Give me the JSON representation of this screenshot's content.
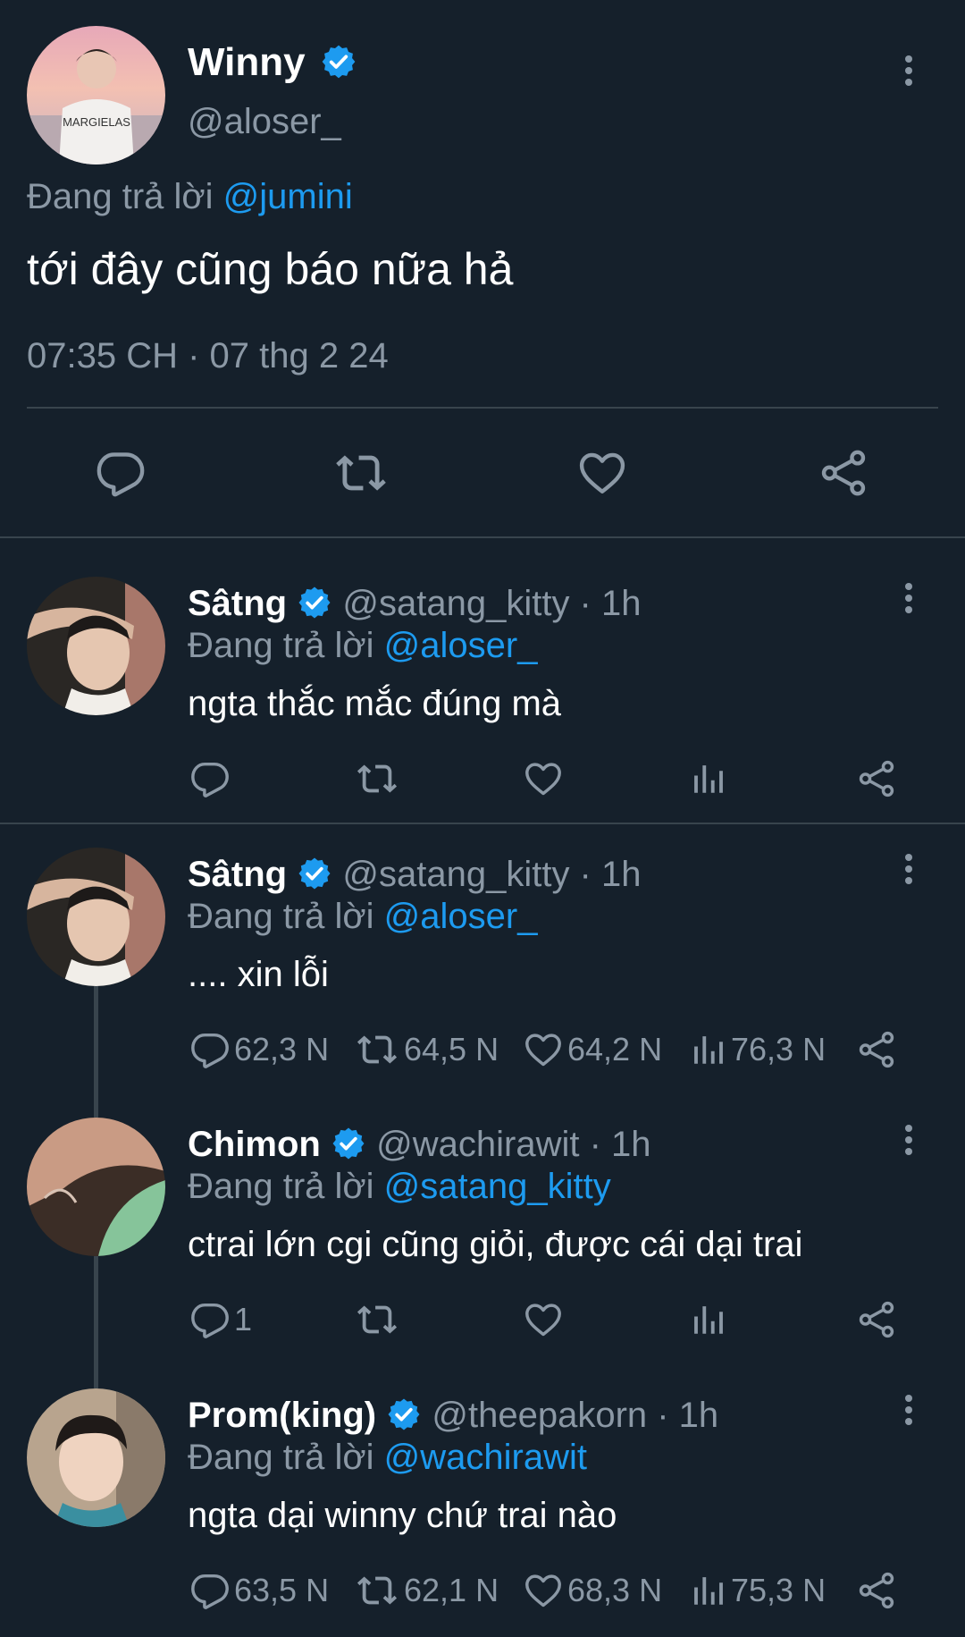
{
  "main_tweet": {
    "name": "Winny",
    "handle": "@aloser_",
    "reply_prefix": "Đang trả lời",
    "reply_to": "@jumini",
    "text": "tới đây cũng báo nữa hả",
    "timestamp": "07:35 CH · 07 thg 2 24"
  },
  "replies": [
    {
      "name": "Sâtng",
      "handle_time": "@satang_kitty · 1h",
      "reply_prefix": "Đang trả lời",
      "reply_to": "@aloser_",
      "text": "ngta thắc mắc đúng mà",
      "replies": "",
      "retweets": "",
      "likes": "",
      "views": ""
    },
    {
      "name": "Sâtng",
      "handle_time": "@satang_kitty · 1h",
      "reply_prefix": "Đang trả lời",
      "reply_to": "@aloser_",
      "text": ".... xin lỗi",
      "replies": "62,3 N",
      "retweets": "64,5 N",
      "likes": "64,2 N",
      "views": "76,3 N"
    },
    {
      "name": "Chimon",
      "handle_time": "@wachirawit · 1h",
      "reply_prefix": "Đang trả lời",
      "reply_to": "@satang_kitty",
      "text": "ctrai lớn cgi cũng giỏi, được cái dại trai",
      "replies": "1",
      "retweets": "",
      "likes": "",
      "views": ""
    },
    {
      "name": "Prom(king)",
      "handle_time": "@theepakorn · 1h",
      "reply_prefix": "Đang trả lời",
      "reply_to": "@wachirawit",
      "text": "ngta dại winny chứ trai nào",
      "replies": "63,5 N",
      "retweets": "62,1 N",
      "likes": "68,3 N",
      "views": "75,3 N"
    }
  ],
  "avatar_labels": {
    "winny_shirt": "MARGIELAS"
  },
  "colors": {
    "background": "#15202b",
    "text": "#ffffff",
    "secondary": "#8b98a5",
    "link": "#1d9bf0",
    "divider": "#38444d",
    "verified": "#1d9bf0"
  },
  "icons": [
    "verified-badge-icon",
    "more-icon",
    "reply-icon",
    "retweet-icon",
    "like-icon",
    "share-icon",
    "views-icon"
  ]
}
